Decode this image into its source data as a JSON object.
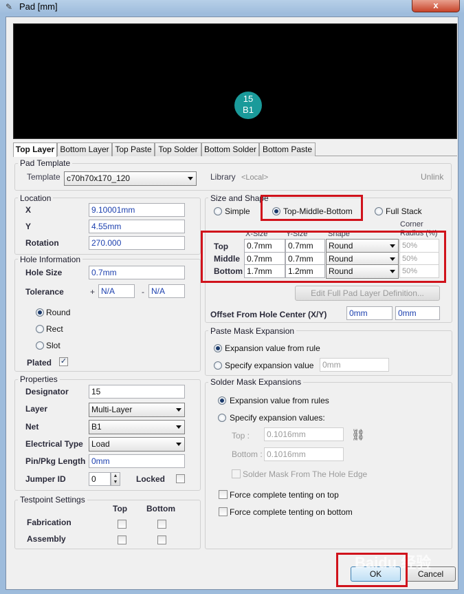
{
  "window": {
    "title": "Pad [mm]",
    "close": "x"
  },
  "preview": {
    "pad_line1": "15",
    "pad_line2": "B1"
  },
  "tabs": [
    "Top Layer",
    "Bottom Layer",
    "Top Paste",
    "Top Solder",
    "Bottom Solder",
    "Bottom Paste"
  ],
  "pad_template": {
    "group": "Pad Template",
    "template_label": "Template",
    "template_value": "c70h70x170_120",
    "library_label": "Library",
    "library_value": "<Local>",
    "unlink": "Unlink"
  },
  "location": {
    "group": "Location",
    "x_label": "X",
    "x_value": "9.10001mm",
    "y_label": "Y",
    "y_value": "4.55mm",
    "rotation_label": "Rotation",
    "rotation_value": "270.000"
  },
  "hole": {
    "group": "Hole Information",
    "size_label": "Hole Size",
    "size_value": "0.7mm",
    "tolerance_label": "Tolerance",
    "tol_plus": "+",
    "tol_plus_value": "N/A",
    "tol_minus": "-",
    "tol_minus_value": "N/A",
    "round": "Round",
    "rect": "Rect",
    "slot": "Slot",
    "plated": "Plated",
    "plated_mark": "✓"
  },
  "properties": {
    "group": "Properties",
    "designator_label": "Designator",
    "designator_value": "15",
    "layer_label": "Layer",
    "layer_value": "Multi-Layer",
    "net_label": "Net",
    "net_value": "B1",
    "etype_label": "Electrical Type",
    "etype_value": "Load",
    "pinpkg_label": "Pin/Pkg Length",
    "pinpkg_value": "0mm",
    "jumper_label": "Jumper ID",
    "jumper_value": "0",
    "locked_label": "Locked"
  },
  "testpoint": {
    "group": "Testpoint Settings",
    "top": "Top",
    "bottom": "Bottom",
    "fabrication": "Fabrication",
    "assembly": "Assembly"
  },
  "size_shape": {
    "group": "Size and Shape",
    "simple": "Simple",
    "tmb": "Top-Middle-Bottom",
    "full": "Full Stack",
    "col_xsize": "X-Size",
    "col_ysize": "Y-Size",
    "col_shape": "Shape",
    "col_corner1": "Corner",
    "col_corner2": "Radius (%)",
    "rows": [
      {
        "label": "Top",
        "x": "0.7mm",
        "y": "0.7mm",
        "shape": "Round",
        "corner": "50%"
      },
      {
        "label": "Middle",
        "x": "0.7mm",
        "y": "0.7mm",
        "shape": "Round",
        "corner": "50%"
      },
      {
        "label": "Bottom",
        "x": "1.7mm",
        "y": "1.2mm",
        "shape": "Round",
        "corner": "50%"
      }
    ],
    "edit_button": "Edit Full Pad Layer Definition...",
    "offset_label": "Offset From Hole Center (X/Y)",
    "offset_x": "0mm",
    "offset_y": "0mm"
  },
  "paste": {
    "group": "Paste Mask Expansion",
    "rule": "Expansion value from rule",
    "specify": "Specify expansion value",
    "value": "0mm"
  },
  "solder": {
    "group": "Solder Mask Expansions",
    "rule": "Expansion value from rules",
    "specify": "Specify expansion values:",
    "top_label": "Top :",
    "top_value": "0.1016mm",
    "bottom_label": "Bottom :",
    "bottom_value": "0.1016mm",
    "hole_edge": "Solder Mask From The Hole Edge",
    "tent_top": "Force complete tenting on top",
    "tent_bottom": "Force complete tenting on bottom"
  },
  "buttons": {
    "ok": "OK",
    "cancel": "Cancel"
  },
  "watermark": "Baidu 经验"
}
